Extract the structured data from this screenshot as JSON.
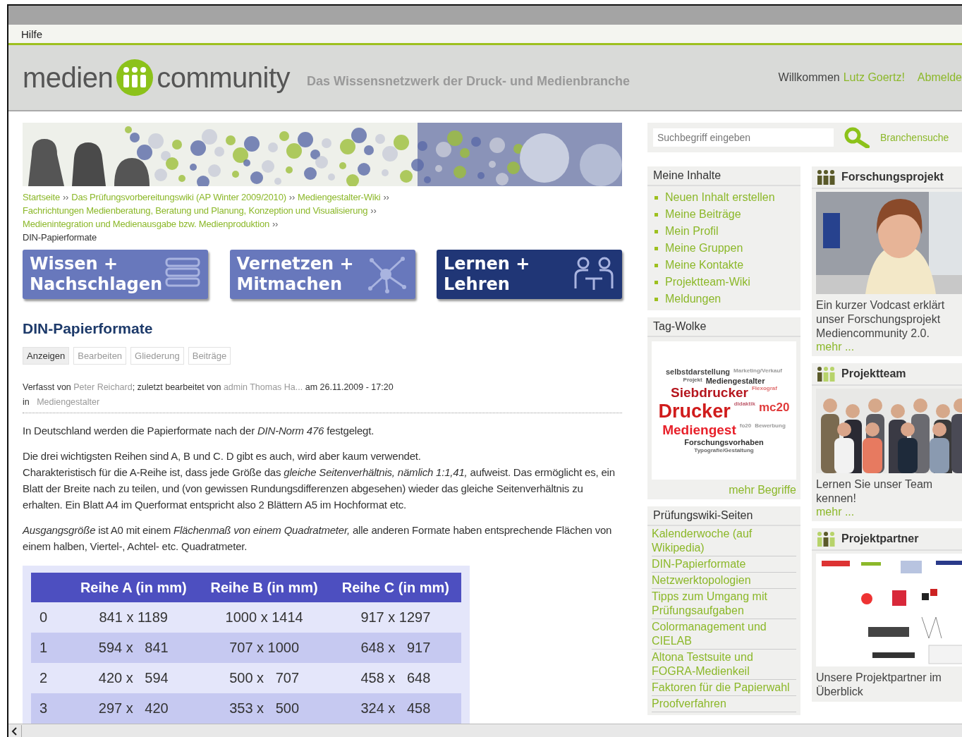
{
  "menu_bar": {
    "items": [
      "Hilfe"
    ]
  },
  "header": {
    "logo_left": "medien",
    "logo_right": "community",
    "tagline": "Das Wissensnetzwerk der Druck- und Medienbranche",
    "welcome": "Willkommen",
    "user": "Lutz Goertz!",
    "logout": "Abmelde"
  },
  "breadcrumb": {
    "links": [
      "Startseite",
      "Das Prüfungsvorbereitungswiki (AP Winter 2009/2010)",
      "Mediengestalter-Wiki",
      "Fachrichtungen Medienberatung, Beratung und Planung, Konzeption und Visualisierung",
      "Medienintegration und Medienausgabe bzw. Medienproduktion"
    ],
    "separator": "››",
    "current": "DIN-Papierformate"
  },
  "sections": [
    {
      "line1": "Wissen +",
      "line2": "Nachschlagen",
      "selected": false
    },
    {
      "line1": "Vernetzen +",
      "line2": "Mitmachen",
      "selected": false
    },
    {
      "line1": "Lernen +",
      "line2": "Lehren",
      "selected": true
    }
  ],
  "article": {
    "title": "DIN-Papierformate",
    "tabs": [
      {
        "label": "Anzeigen",
        "selected": true
      },
      {
        "label": "Bearbeiten",
        "selected": false
      },
      {
        "label": "Gliederung",
        "selected": false
      },
      {
        "label": "Beiträge",
        "selected": false
      }
    ],
    "meta": {
      "prefix": "Verfasst von",
      "author": "Peter Reichard",
      "middle": "; zuletzt bearbeitet von",
      "editor": "admin Thomas Ha...",
      "date": "am 26.11.2009 - 17:20",
      "in": "in",
      "category": "Mediengestalter"
    },
    "paragraphs": [
      {
        "lines": [
          "In Deutschland werden die Papierformate nach der *DIN-Norm 476* festgelegt."
        ]
      },
      {
        "lines": [
          "Die drei wichtigsten Reihen sind A, B und C. D gibt es auch, wird aber kaum verwendet.",
          "Charakteristisch für die A-Reihe ist, dass jede Größe das *gleiche Seitenverhältnis, nämlich 1:1,41,* aufweist. Das ermöglicht es, ein Blatt der Breite nach zu teilen, und (von gewissen Rundungsdifferenzen abgesehen) wieder das gleiche Seitenverhältnis zu erhalten. Ein Blatt A4 im Querformat entspricht also 2 Blättern A5 im Hochformat etc."
        ]
      },
      {
        "lines": [
          "*Ausgangsgröße* ist A0 mit einem *Flächenmaß von einem Quadratmeter,* alle anderen Formate haben entsprechende Flächen von einem halben, Viertel-, Achtel- etc. Quadratmeter."
        ]
      }
    ],
    "table": {
      "columns": [
        "",
        "Reihe A (in mm)",
        "Reihe B (in mm)",
        "Reihe C (in mm)"
      ],
      "rows": [
        {
          "cells": [
            "0",
            "841 x 1189",
            "1000 x 1414",
            "917 x 1297"
          ]
        },
        {
          "cells": [
            "1",
            "594 x   841",
            "707 x 1000",
            "648 x   917"
          ]
        },
        {
          "cells": [
            "2",
            "420 x   594",
            "500 x   707",
            "458 x   648"
          ]
        },
        {
          "cells": [
            "3",
            "297 x   420",
            "353 x   500",
            "324 x   458"
          ]
        }
      ]
    }
  },
  "search": {
    "placeholder": "Suchbegriff eingeben",
    "link": "Branchensuche"
  },
  "meine_inhalte": {
    "title": "Meine Inhalte",
    "items": [
      "Neuen Inhalt erstellen",
      "Meine Beiträge",
      "Mein Profil",
      "Meine Gruppen",
      "Meine Kontakte",
      "Projektteam-Wiki",
      "Meldungen"
    ]
  },
  "tag_cloud": {
    "title": "Tag-Wolke",
    "more": "mehr Begriffe",
    "tags": [
      {
        "text": "selbstdarstellung",
        "kind": "s",
        "color": "#444444"
      },
      {
        "text": "Marketing/Verkauf",
        "kind": "xs",
        "color": "#999999"
      },
      {
        "text": "Projekt",
        "kind": "xs",
        "color": "#666666"
      },
      {
        "text": "Mediengestalter",
        "kind": "s",
        "color": "#333333"
      },
      {
        "text": "Siebdrucker",
        "kind": "l",
        "color": "#b5161e"
      },
      {
        "text": "Flexograf",
        "kind": "xs",
        "color": "#e07070"
      },
      {
        "text": "Drucker",
        "kind": "xl",
        "color": "#d01c1c"
      },
      {
        "text": "didaktik",
        "kind": "xs",
        "color": "#c06070"
      },
      {
        "text": "mc20",
        "kind": "m",
        "color": "#e03a3a"
      },
      {
        "text": "Mediengest",
        "kind": "l",
        "color": "#e8202a"
      },
      {
        "text": "fo20",
        "kind": "xs",
        "color": "#999999"
      },
      {
        "text": "Bewerbung",
        "kind": "xs",
        "color": "#999999"
      },
      {
        "text": "Forschungsvorhaben",
        "kind": "s",
        "color": "#333333"
      },
      {
        "text": "Typografie/Gestaltung",
        "kind": "xs",
        "color": "#666666"
      }
    ]
  },
  "pruefungswiki": {
    "title": "Prüfungswiki-Seiten",
    "links": [
      "Kalenderwoche (auf Wikipedia)",
      "DIN-Papierformate",
      "Netzwerktopologien",
      "Tipps zum Umgang mit Prüfungsaufgaben",
      "Colormanagement und CIELAB",
      "Altona Testsuite und FOGRA-Medienkeil",
      "Faktoren für die Papierwahl",
      "Proofverfahren"
    ]
  },
  "boxes": [
    {
      "title": "Forschungsprojekt",
      "text": "Ein kurzer Vodcast erklärt unser Forschungsprojekt Mediencommunity 2.0.",
      "more": "mehr ..."
    },
    {
      "title": "Projektteam",
      "text": "Lernen Sie unser Team kennen!",
      "more": "mehr ...",
      "kind": "team"
    },
    {
      "title": "Projektpartner",
      "text": "Unsere Projektpartner im Überblick",
      "kind": "logos"
    }
  ]
}
